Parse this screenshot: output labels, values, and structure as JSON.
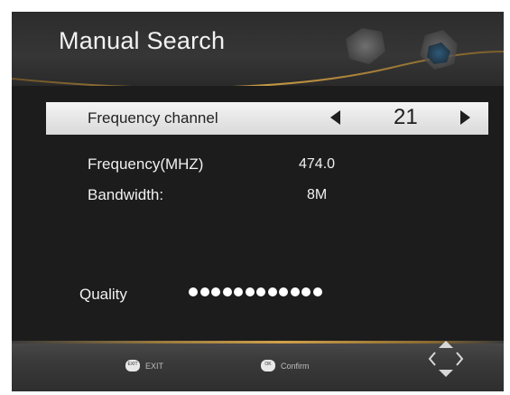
{
  "header": {
    "title": "Manual Search"
  },
  "channel_row": {
    "label": "Frequency channel",
    "value": "21"
  },
  "info": {
    "frequency_label": "Frequency(MHZ)",
    "frequency_value": "474.0",
    "bandwidth_label": "Bandwidth:",
    "bandwidth_value": "8M"
  },
  "quality": {
    "label": "Quality",
    "level_dots": 12
  },
  "footer": {
    "exit_icon_text": "EXIT",
    "exit_label": "EXIT",
    "ok_icon_text": "OK",
    "confirm_label": "Confirm",
    "nav_icon": "dpad-navigate-icon"
  },
  "colors": {
    "accent_gold": "#d0a04a",
    "highlight": "#e6e6e6",
    "background": "#1b1b1b"
  }
}
